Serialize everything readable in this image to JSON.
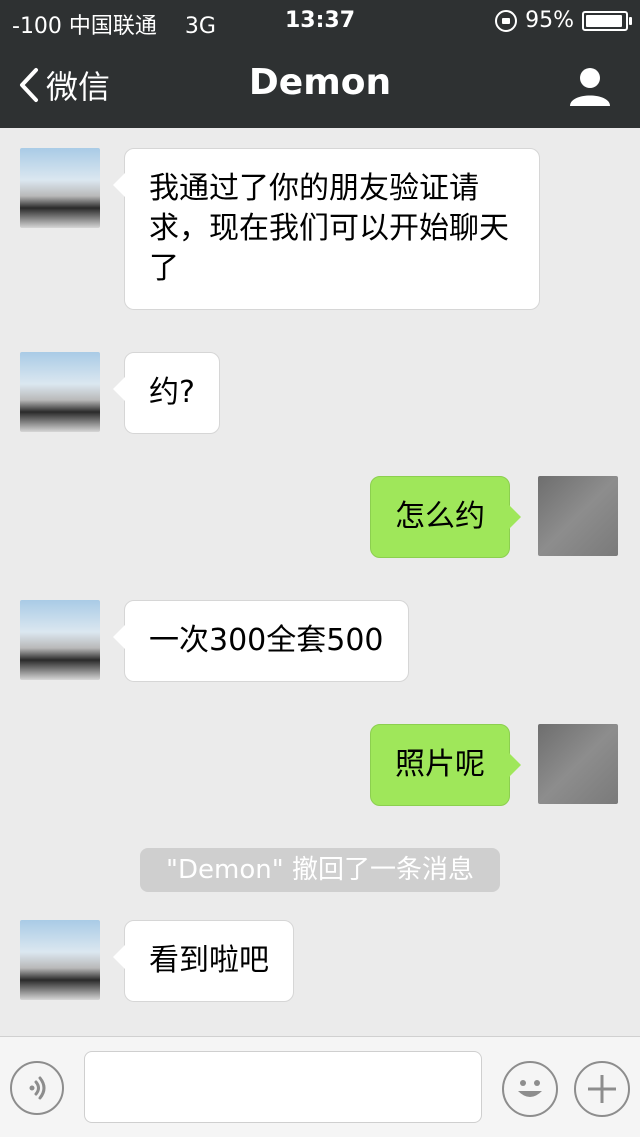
{
  "status": {
    "carrier": "-100 中国联通",
    "network": "3G",
    "time": "13:37",
    "battery": "95%"
  },
  "nav": {
    "back_label": "微信",
    "title": "Demon"
  },
  "messages": [
    {
      "side": "left",
      "text": "我通过了你的朋友验证请求，现在我们可以开始聊天了"
    },
    {
      "side": "left",
      "text": "约?"
    },
    {
      "side": "right",
      "text": "怎么约"
    },
    {
      "side": "left",
      "text": "一次300全套500"
    },
    {
      "side": "right",
      "text": "照片呢"
    },
    {
      "side": "left",
      "text": "看到啦吧"
    }
  ],
  "system_notice": "\"Demon\" 撤回了一条消息",
  "colors": {
    "topbar": "#2e3132",
    "background": "#ebebeb",
    "bubble_left": "#ffffff",
    "bubble_right": "#9fe75a"
  },
  "icons": {
    "back": "chevron-left-icon",
    "profile": "person-icon",
    "voice": "voice-icon",
    "emoji": "smiley-icon",
    "plus": "plus-icon"
  }
}
